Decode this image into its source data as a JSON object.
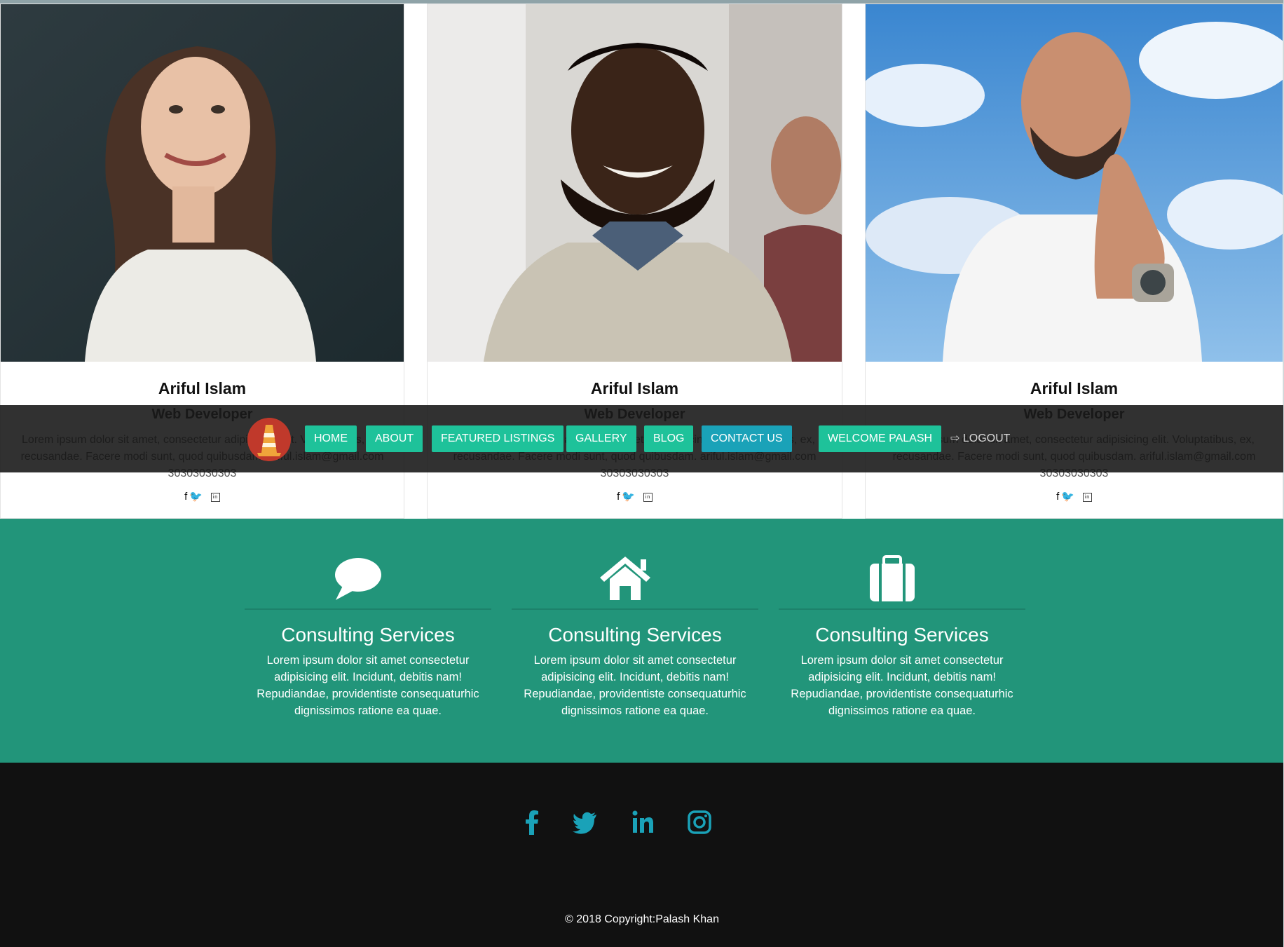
{
  "team": [
    {
      "name": "Ariful Islam",
      "role": "Web Developer",
      "desc": "Lorem ipsum dolor sit amet, consectetur adipisicing elit. Voluptatibus, ex, recusandae. Facere modi sunt, quod quibusdam. ariful.islam@gmail.com 30303030303"
    },
    {
      "name": "Ariful Islam",
      "role": "Web Developer",
      "desc": "Lorem ipsum dolor sit amet, consectetur adipisicing elit. Voluptatibus, ex, recusandae. Facere modi sunt, quod quibusdam. ariful.islam@gmail.com 30303030303"
    },
    {
      "name": "Ariful Islam",
      "role": "Web Developer",
      "desc": "Lorem ipsum dolor sit amet, consectetur adipisicing elit. Voluptatibus, ex, recusandae. Facere modi sunt, quod quibusdam. ariful.islam@gmail.com 30303030303"
    }
  ],
  "nav": {
    "items": [
      "HOME",
      "ABOUT",
      "FEATURED LISTINGS",
      "GALLERY",
      "BLOG",
      "CONTACT US"
    ],
    "welcome": "WELCOME PALASH",
    "logout": "LOGOUT",
    "active_color": "#1aa2b8",
    "button_color": "#1ec29a"
  },
  "services": [
    {
      "icon": "comment-icon",
      "title": "Consulting Services",
      "text": "Lorem ipsum dolor sit amet consectetur adipisicing elit. Incidunt, debitis nam! Repudiandae, providentiste consequaturhic dignissimos ratione ea quae."
    },
    {
      "icon": "home-icon",
      "title": "Consulting Services",
      "text": "Lorem ipsum dolor sit amet consectetur adipisicing elit. Incidunt, debitis nam! Repudiandae, providentiste consequaturhic dignissimos ratione ea quae."
    },
    {
      "icon": "suitcase-icon",
      "title": "Consulting Services",
      "text": "Lorem ipsum dolor sit amet consectetur adipisicing elit. Incidunt, debitis nam! Repudiandae, providentiste consequaturhic dignissimos ratione ea quae."
    }
  ],
  "footer": {
    "social_icons": [
      "facebook-icon",
      "twitter-icon",
      "linkedin-icon",
      "instagram-icon"
    ],
    "icon_color": "#1aa2b8",
    "copyright": "© 2018 Copyright:Palash Khan"
  },
  "colors": {
    "services_bg": "#22957a",
    "footer_bg": "#111111"
  }
}
